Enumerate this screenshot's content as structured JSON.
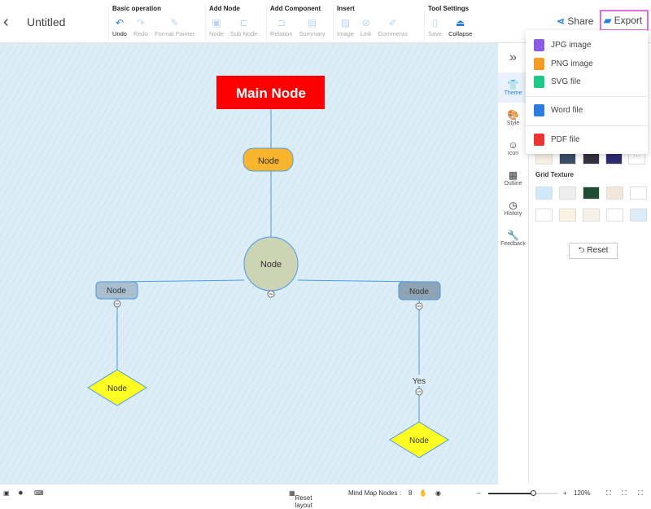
{
  "header": {
    "back": "‹",
    "title": "Untitled",
    "share": "Share",
    "export": "Export"
  },
  "groups": [
    {
      "title": "Basic operation",
      "tools": [
        {
          "label": "Undo",
          "icon": "↶",
          "on": true
        },
        {
          "label": "Redo",
          "icon": "↷"
        },
        {
          "label": "Format Painter",
          "icon": "✎"
        }
      ]
    },
    {
      "title": "Add Node",
      "tools": [
        {
          "label": "Node",
          "icon": "▣"
        },
        {
          "label": "Sub Node",
          "icon": "⊏"
        }
      ]
    },
    {
      "title": "Add Component",
      "tools": [
        {
          "label": "Relation",
          "icon": "⊐"
        },
        {
          "label": "Summary",
          "icon": "▤"
        }
      ]
    },
    {
      "title": "Insert",
      "tools": [
        {
          "label": "Image",
          "icon": "▨"
        },
        {
          "label": "Link",
          "icon": "⊘"
        },
        {
          "label": "Comments",
          "icon": "✐"
        }
      ]
    },
    {
      "title": "Tool Settings",
      "tools": [
        {
          "label": "Save",
          "icon": "▯"
        },
        {
          "label": "Collapse",
          "icon": "⏏",
          "on": true
        }
      ]
    }
  ],
  "export_menu": [
    {
      "label": "JPG image",
      "color": "#8a5ce6"
    },
    {
      "label": "PNG image",
      "color": "#f59a23"
    },
    {
      "label": "SVG file",
      "color": "#1fc98a"
    },
    {
      "label": "Word file",
      "color": "#2b7de0"
    },
    {
      "label": "PDF file",
      "color": "#e33"
    }
  ],
  "sidebar": {
    "collapse": "»",
    "items": [
      {
        "label": "Theme",
        "icon": "👕"
      },
      {
        "label": "Style",
        "icon": "🎨"
      },
      {
        "label": "Icon",
        "icon": "☺"
      },
      {
        "label": "Outline",
        "icon": "▦"
      },
      {
        "label": "History",
        "icon": "◷"
      },
      {
        "label": "Feedback",
        "icon": "🔧"
      }
    ]
  },
  "panel": {
    "grid_texture": "Grid Texture",
    "reset": "Reset",
    "more": "···"
  },
  "mindmap": {
    "main": "Main Node",
    "node": "Node",
    "yes": "Yes",
    "main_color": "#ff0000"
  },
  "footer": {
    "reset_layout": "Reset layout",
    "nodes_label": "Mind Map Nodes :",
    "nodes_count": "8",
    "zoom": "120%",
    "zoom_level": 0.65
  }
}
